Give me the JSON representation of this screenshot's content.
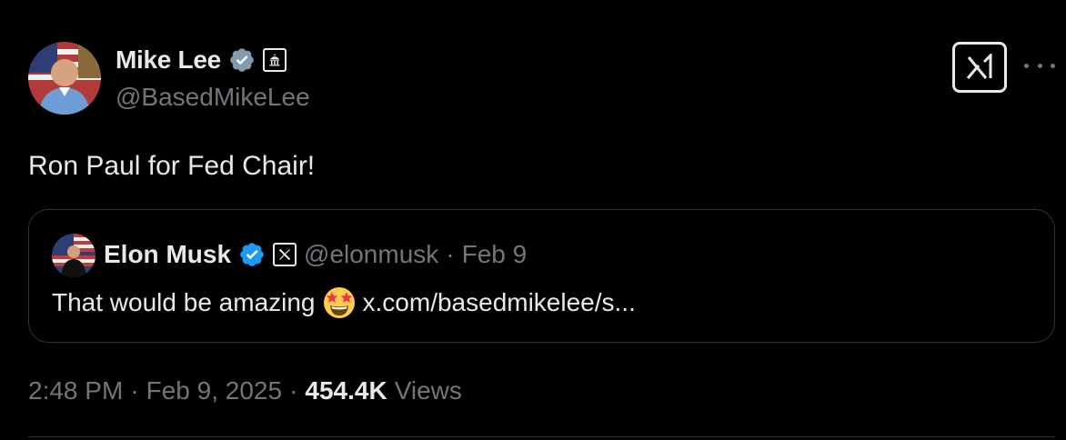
{
  "author": {
    "display_name": "Mike Lee",
    "handle": "@BasedMikeLee",
    "verified": true,
    "affiliation_icon": "government-building-icon",
    "avatar_icon": "avatar-photo"
  },
  "tweet": {
    "text": "Ron Paul for Fed Chair!"
  },
  "quoted": {
    "display_name": "Elon Musk",
    "verified": true,
    "affiliation_icon": "x-logo-icon",
    "handle": "@elonmusk",
    "separator": "·",
    "date": "Feb 9",
    "text": "That would be amazing",
    "emoji": "star-struck-emoji",
    "link": "x.com/basedmikelee/s..."
  },
  "meta": {
    "time": "2:48 PM",
    "sep1": "·",
    "date": "Feb 9, 2025",
    "sep2": "·",
    "views_count": "454.4K",
    "views_label": "Views"
  },
  "colors": {
    "background": "#000000",
    "primary_text": "#e7e9ea",
    "secondary_text": "#71767b",
    "verified_blue": "#1d9bf0",
    "verified_gray": "#829aab",
    "border": "#2f3336"
  }
}
